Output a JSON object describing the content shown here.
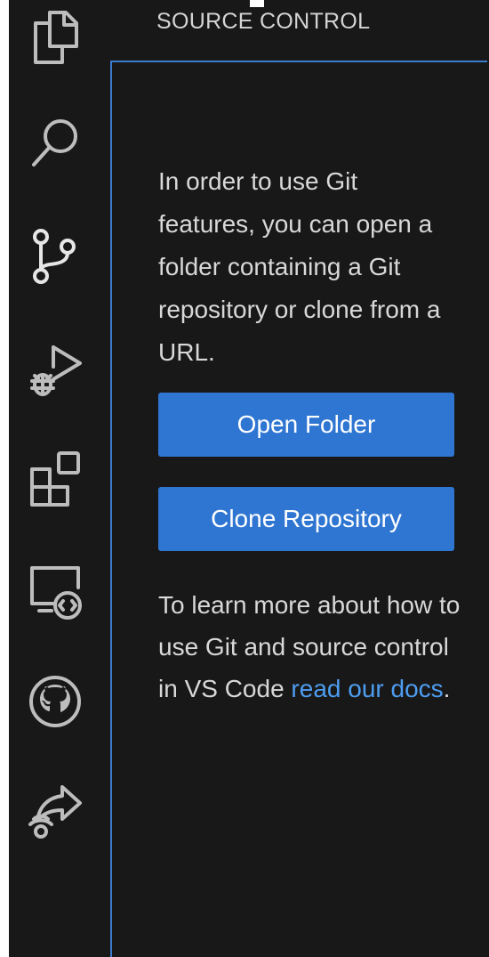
{
  "activity_bar": {
    "icons": [
      "explorer-icon",
      "search-icon",
      "source-control-icon",
      "run-debug-icon",
      "extensions-icon",
      "remote-explorer-icon",
      "github-icon",
      "live-share-icon"
    ]
  },
  "sidebar": {
    "title": "SOURCE CONTROL",
    "intro_text": "In order to use Git features, you can open a folder containing a Git repository or clone from a URL.",
    "open_folder_label": "Open Folder",
    "clone_repository_label": "Clone Repository",
    "outro_prefix": "To learn more about how to use Git and source control in VS Code ",
    "docs_link_text": "read our docs",
    "outro_suffix": "."
  },
  "colors": {
    "background": "#181818",
    "button": "#2f76d2",
    "link": "#4d9df0",
    "focus_border": "#3b7ccf",
    "icon": "#bdbdbd"
  }
}
